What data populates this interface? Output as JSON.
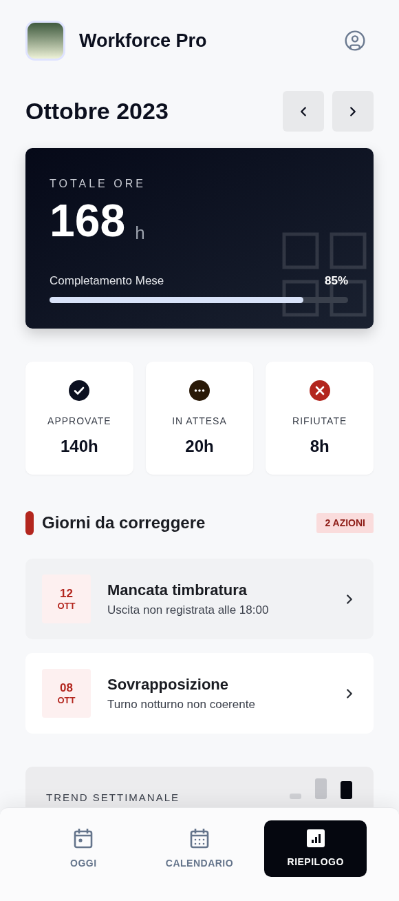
{
  "app": {
    "title": "Workforce Pro"
  },
  "month": {
    "title": "Ottobre 2023"
  },
  "summary": {
    "label": "TOTALE ORE",
    "value": "168",
    "unit": "h",
    "progress_label": "Completamento Mese",
    "progress_reading": "85%",
    "level": 0.85
  },
  "stats": [
    {
      "kind": "approved",
      "label": "APPROVATE",
      "value": "140h"
    },
    {
      "kind": "pending",
      "label": "IN ATTESA",
      "value": "20h"
    },
    {
      "kind": "rejected",
      "label": "RIFIUTATE",
      "value": "8h"
    }
  ],
  "corrections": {
    "title": "Giorni da correggere",
    "badge": "2 AZIONI",
    "items": [
      {
        "day": "12",
        "month": "OTT",
        "title": "Mancata timbratura",
        "subtitle": "Uscita non registrata alle 18:00",
        "selected": true
      },
      {
        "day": "08",
        "month": "OTT",
        "title": "Sovrapposizione",
        "subtitle": "Turno notturno non coerente",
        "selected": false
      }
    ]
  },
  "trend": {
    "title": "TREND SETTIMANALE"
  },
  "nav": [
    {
      "kind": "today",
      "label": "OGGI",
      "selected": false
    },
    {
      "kind": "calendar",
      "label": "CALENDARIO",
      "selected": false
    },
    {
      "kind": "summary",
      "label": "RIEPILOGO",
      "selected": true
    }
  ]
}
